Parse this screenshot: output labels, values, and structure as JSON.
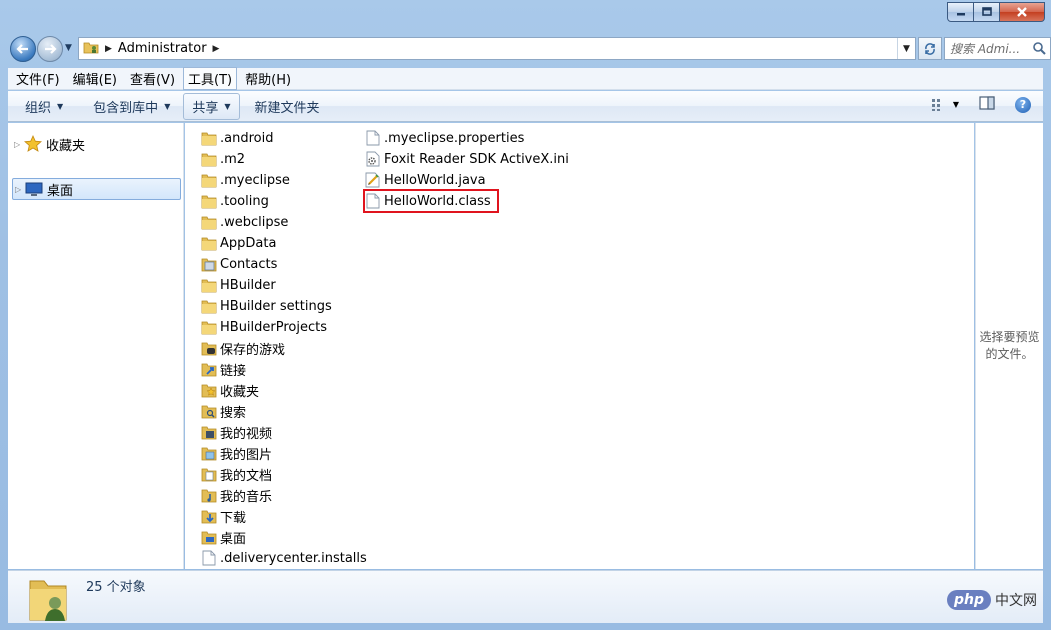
{
  "window": {
    "caption": {
      "minimize": "—",
      "maximize": "□",
      "close": "✕"
    }
  },
  "address_bar": {
    "breadcrumb": "Administrator",
    "search_placeholder": "搜索 Admi..."
  },
  "menu": {
    "items": [
      {
        "label": "文件(F)"
      },
      {
        "label": "编辑(E)"
      },
      {
        "label": "查看(V)"
      },
      {
        "label": "工具(T)",
        "active": true
      },
      {
        "label": "帮助(H)"
      }
    ]
  },
  "toolbar": {
    "organize": "组织",
    "include_in_library": "包含到库中",
    "share": "共享",
    "new_folder": "新建文件夹"
  },
  "nav_pane": {
    "favorites": "收藏夹",
    "desktop": "桌面"
  },
  "files": {
    "column1": [
      {
        "name": ".android",
        "icon": "folder"
      },
      {
        "name": ".m2",
        "icon": "folder"
      },
      {
        "name": ".myeclipse",
        "icon": "folder"
      },
      {
        "name": ".tooling",
        "icon": "folder"
      },
      {
        "name": ".webclipse",
        "icon": "folder"
      },
      {
        "name": "AppData",
        "icon": "folder"
      },
      {
        "name": "Contacts",
        "icon": "contacts-folder"
      },
      {
        "name": "HBuilder",
        "icon": "folder"
      },
      {
        "name": "HBuilder settings",
        "icon": "folder"
      },
      {
        "name": "HBuilderProjects",
        "icon": "folder"
      },
      {
        "name": "保存的游戏",
        "icon": "games-folder"
      },
      {
        "name": "链接",
        "icon": "links-folder"
      },
      {
        "name": "收藏夹",
        "icon": "favorites-folder"
      },
      {
        "name": "搜索",
        "icon": "search-folder"
      },
      {
        "name": "我的视频",
        "icon": "videos-folder"
      },
      {
        "name": "我的图片",
        "icon": "pictures-folder"
      },
      {
        "name": "我的文档",
        "icon": "documents-folder"
      },
      {
        "name": "我的音乐",
        "icon": "music-folder"
      },
      {
        "name": "下载",
        "icon": "downloads-folder"
      },
      {
        "name": "桌面",
        "icon": "desktop-folder"
      },
      {
        "name": ".deliverycenter.installs",
        "icon": "file"
      }
    ],
    "column2": [
      {
        "name": ".myeclipse.properties",
        "icon": "file"
      },
      {
        "name": "Foxit Reader SDK ActiveX.ini",
        "icon": "ini-file"
      },
      {
        "name": "HelloWorld.java",
        "icon": "java-file"
      },
      {
        "name": "HelloWorld.class",
        "icon": "file",
        "highlighted": true
      }
    ]
  },
  "preview_pane": {
    "message": "选择要预览的文件。"
  },
  "details_pane": {
    "item_count": "25 个对象"
  },
  "watermark": {
    "brand": "php",
    "site": "中文网"
  },
  "colors": {
    "frame": "#a9c9ea",
    "selection": "#d3e6fb",
    "highlight_box": "#e0141e"
  }
}
